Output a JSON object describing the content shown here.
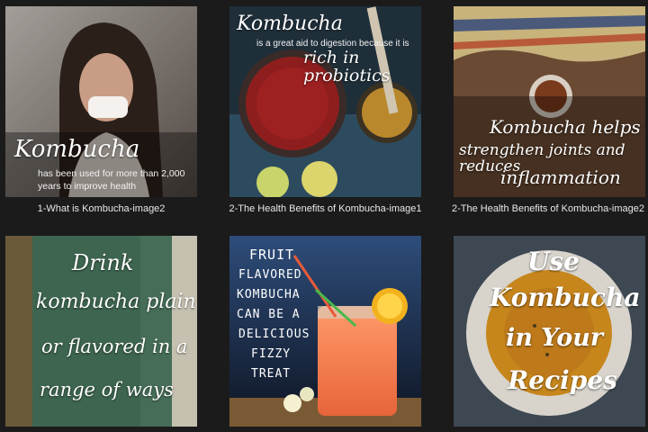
{
  "theme": {
    "background": "#1b1b1b",
    "caption_color": "#e8e8e8"
  },
  "tiles": [
    {
      "caption": "1-What is Kombucha-image2",
      "title": "Kombucha",
      "text_line1": "has been used for more than 2,000",
      "text_line2": "years to improve health"
    },
    {
      "caption": "2-The Health Benefits of Kombucha-image1",
      "title": "Kombucha",
      "text_line1": "is a great aid to digestion because it is",
      "emphasis": "rich in probiotics"
    },
    {
      "caption": "2-The Health Benefits of Kombucha-image2",
      "line1": "Kombucha helps",
      "line2": "strengthen joints and reduces",
      "line3": "inflammation"
    },
    {
      "line1": "Drink",
      "line2": "kombucha plain",
      "line3": "or flavored in a",
      "line4": "range of ways"
    },
    {
      "line1": "Fruit",
      "line2": "flavored",
      "line3": "kombucha",
      "line4": "can be a",
      "line5": "delicious",
      "line6": "fizzy",
      "line7": "treat"
    },
    {
      "line1": "Use",
      "line2": "Kombucha",
      "line3": "in Your",
      "line4": "Recipes"
    }
  ]
}
